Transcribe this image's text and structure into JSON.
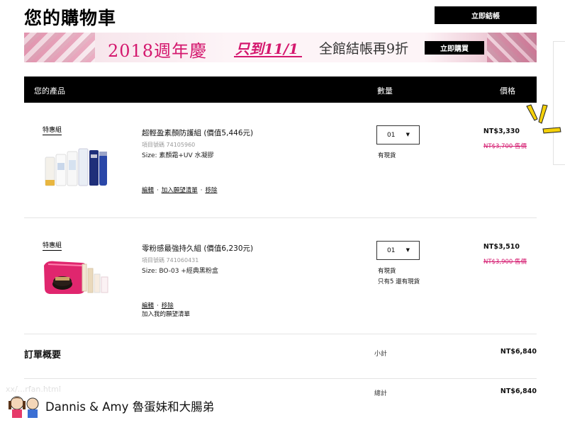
{
  "header": {
    "title": "您的購物車",
    "checkout_label": "立即結帳"
  },
  "banner": {
    "anniversary": "2018週年慶",
    "until": "只到11/1",
    "offer": "全館結帳再9折",
    "buy_label": "立即購買"
  },
  "table_header": {
    "product": "您的產品",
    "quantity": "數量",
    "price": "價格"
  },
  "items": [
    {
      "badge": "特惠組",
      "name": "超輕盈素顏防護組 (價值5,446元)",
      "code": "項目號碼 741059​60",
      "size": "Size: 素顏霜+UV 水凝膠",
      "actions": [
        "編輯",
        "加入願望清單",
        "移除"
      ],
      "quantity": "01",
      "stock": "有現貨",
      "price": "NT$3,330",
      "old_price": "NT$3,700 售價"
    },
    {
      "badge": "特惠組",
      "name": "零粉感最強持久組 (價值6,230元)",
      "code": "項目號碼 741060431",
      "size": "Size: BO-03 +經典黑粉盒",
      "actions": [
        "編輯",
        "移除"
      ],
      "wishlist_text": "加入我的願望清單",
      "quantity": "01",
      "stock": "有現貨",
      "stock_note": "只有5 還有現貨",
      "price": "NT$3,510",
      "old_price": "NT$3,900 售價"
    }
  ],
  "summary": {
    "title": "訂單概要",
    "subtotal_label": "小計",
    "subtotal": "NT$6,840",
    "total_label": "總計",
    "total": "NT$6,840"
  },
  "watermark": {
    "text": "Dannis & Amy 魯蛋妹和大腸弟",
    "url_fragment": "xx/...rfan.html"
  },
  "colors": {
    "accent_pink": "#d4186e",
    "header_black": "#000000"
  }
}
